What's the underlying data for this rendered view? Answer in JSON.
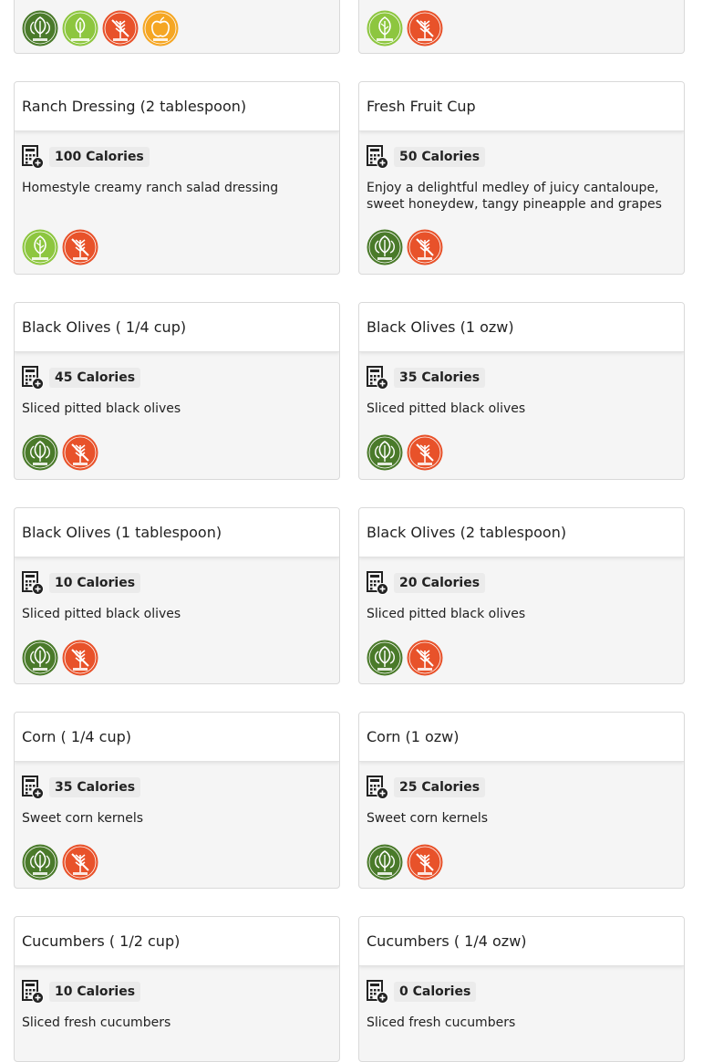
{
  "colors": {
    "vegan": "#4a7a2a",
    "vegetarian": "#8dc63f",
    "gluten_free": "#e8522a",
    "plant_forward": "#8dc63f",
    "eat_well": "#f5a623"
  },
  "cards": [
    {
      "title": "",
      "calories": "",
      "description": "",
      "badges": [
        "vegan-icon",
        "plant-forward-icon",
        "gluten-free-icon",
        "eat-well-icon"
      ]
    },
    {
      "title": "",
      "calories": "",
      "description": "",
      "badges": [
        "vegetarian-icon",
        "gluten-free-icon"
      ]
    },
    {
      "title": "Ranch Dressing (2 tablespoon)",
      "calories": "100 Calories",
      "description": "Homestyle creamy ranch salad dressing",
      "badges": [
        "vegetarian-icon",
        "gluten-free-icon"
      ]
    },
    {
      "title": "Fresh Fruit Cup",
      "calories": "50 Calories",
      "description": "Enjoy a delightful medley of juicy cantaloupe, sweet honeydew, tangy pineapple and grapes",
      "badges": [
        "vegan-icon",
        "gluten-free-icon"
      ]
    },
    {
      "title": "Black Olives ( 1/4 cup)",
      "calories": "45 Calories",
      "description": "Sliced pitted black olives",
      "badges": [
        "vegan-icon",
        "gluten-free-icon"
      ]
    },
    {
      "title": "Black Olives (1 ozw)",
      "calories": "35 Calories",
      "description": "Sliced pitted black olives",
      "badges": [
        "vegan-icon",
        "gluten-free-icon"
      ]
    },
    {
      "title": "Black Olives (1 tablespoon)",
      "calories": "10 Calories",
      "description": "Sliced pitted black olives",
      "badges": [
        "vegan-icon",
        "gluten-free-icon"
      ]
    },
    {
      "title": "Black Olives (2 tablespoon)",
      "calories": "20 Calories",
      "description": "Sliced pitted black olives",
      "badges": [
        "vegan-icon",
        "gluten-free-icon"
      ]
    },
    {
      "title": "Corn ( 1/4 cup)",
      "calories": "35 Calories",
      "description": "Sweet corn kernels",
      "badges": [
        "vegan-icon",
        "gluten-free-icon"
      ]
    },
    {
      "title": "Corn (1 ozw)",
      "calories": "25 Calories",
      "description": "Sweet corn kernels",
      "badges": [
        "vegan-icon",
        "gluten-free-icon"
      ]
    },
    {
      "title": "Cucumbers ( 1/2 cup)",
      "calories": "10 Calories",
      "description": "Sliced fresh cucumbers",
      "badges": []
    },
    {
      "title": "Cucumbers ( 1/4 ozw)",
      "calories": "0 Calories",
      "description": "Sliced fresh cucumbers",
      "badges": []
    }
  ]
}
